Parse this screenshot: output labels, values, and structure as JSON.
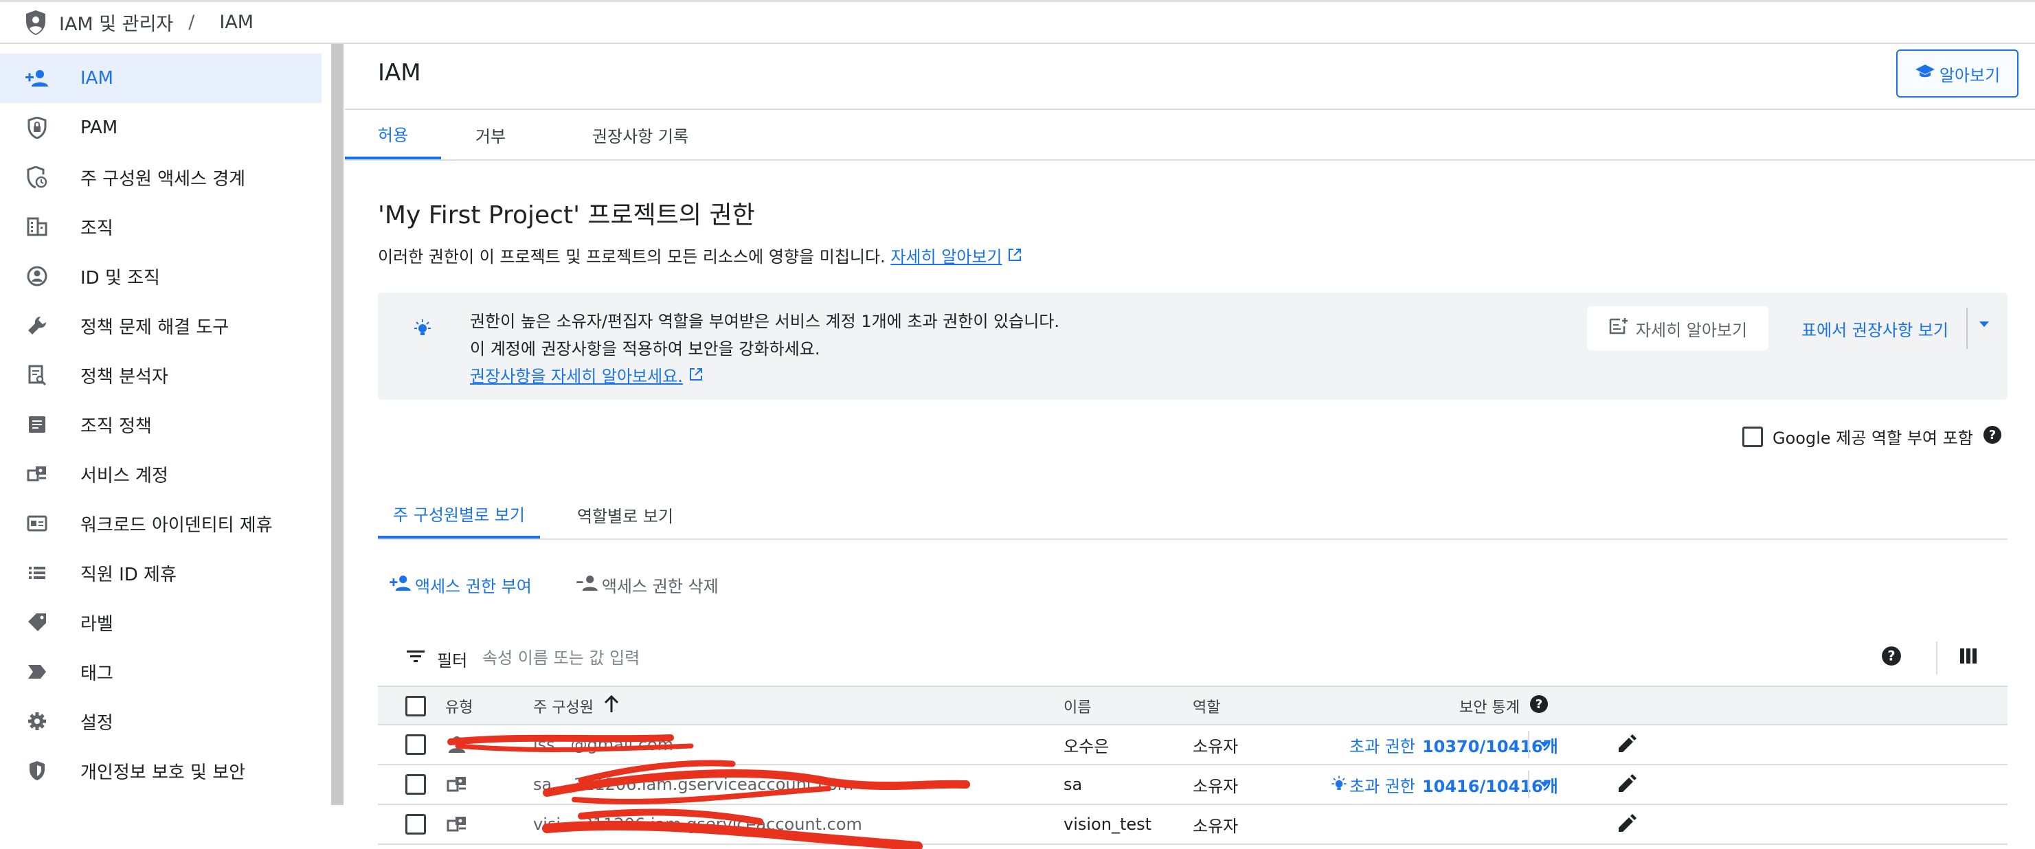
{
  "breadcrumb": {
    "section": "IAM 및 관리자",
    "separator": "/",
    "current": "IAM"
  },
  "sidebar": {
    "items": [
      {
        "label": "IAM",
        "icon": "person-add-icon",
        "active": true
      },
      {
        "label": "PAM",
        "icon": "shield-lock-icon"
      },
      {
        "label": "주 구성원 액세스 경계",
        "icon": "shield-clock-icon"
      },
      {
        "label": "조직",
        "icon": "building-icon"
      },
      {
        "label": "ID 및 조직",
        "icon": "account-circle-icon"
      },
      {
        "label": "정책 문제 해결 도구",
        "icon": "wrench-icon"
      },
      {
        "label": "정책 분석자",
        "icon": "document-search-icon"
      },
      {
        "label": "조직 정책",
        "icon": "list-alt-icon"
      },
      {
        "label": "서비스 계정",
        "icon": "service-account-icon"
      },
      {
        "label": "워크로드 아이덴티티 제휴",
        "icon": "id-card-icon"
      },
      {
        "label": "직원 ID 제휴",
        "icon": "list-icon"
      },
      {
        "label": "라벨",
        "icon": "tag-icon"
      },
      {
        "label": "태그",
        "icon": "chevron-tag-icon"
      },
      {
        "label": "설정",
        "icon": "gear-icon"
      },
      {
        "label": "개인정보 보호 및 보안",
        "icon": "shield-icon"
      }
    ]
  },
  "main": {
    "title": "IAM",
    "learn_button": "알아보기",
    "tabs": [
      "허용",
      "거부",
      "권장사항 기록"
    ],
    "section_title": "'My First Project' 프로젝트의 권한",
    "section_desc": "이러한 권한이 이 프로젝트 및 프로젝트의 모든 리소스에 영향을 미칩니다.",
    "section_link": "자세히 알아보기",
    "banner": {
      "line1": "권한이 높은 소유자/편집자 역할을 부여받은 서비스 계정 1개에 초과 권한이 있습니다.",
      "line2": "이 계정에 권장사항을 적용하여 보안을 강화하세요.",
      "link": "권장사항을 자세히 알아보세요.",
      "learn_btn": "자세히 알아보기",
      "table_btn": "표에서 권장사항 보기"
    },
    "google_roles_label": "Google 제공 역할 부여 포함",
    "subtabs": [
      "주 구성원별로 보기",
      "역할별로 보기"
    ],
    "actions": {
      "grant": "액세스 권한 부여",
      "remove": "액세스 권한 삭제"
    },
    "filter": {
      "label": "필터",
      "placeholder": "속성 이름 또는 값 입력"
    },
    "table": {
      "headers": {
        "type": "유형",
        "principal": "주 구성원",
        "name": "이름",
        "role": "역할",
        "security": "보안 통계"
      },
      "rows": [
        {
          "principal": "iss...@gmail.com",
          "name": "오수은",
          "role": "소유자",
          "excess_label": "초과 권한",
          "excess_value": "10370/10416개"
        },
        {
          "principal": "sa...-311206.iam.gserviceaccount.com",
          "name": "sa",
          "role": "소유자",
          "excess_label": "초과 권한",
          "excess_value": "10416/10416개"
        },
        {
          "principal": "visi...-311206.iam.gserviceaccount.com",
          "name": "vision_test",
          "role": "소유자"
        }
      ]
    }
  },
  "colors": {
    "accent": "#1a73e8",
    "active_bg": "#e8f0fe",
    "scribble": "#e8321e"
  }
}
